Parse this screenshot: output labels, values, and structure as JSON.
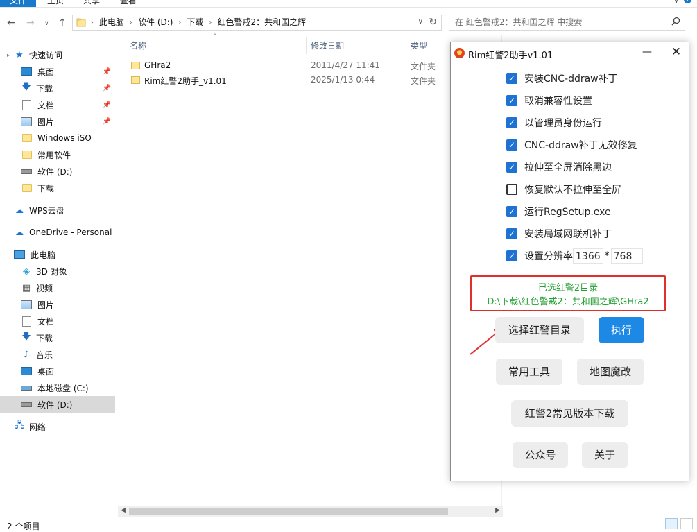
{
  "ribbon": {
    "tabs": [
      "文件",
      "主页",
      "共享",
      "查看"
    ],
    "expand": "∨",
    "help": "?"
  },
  "nav": {
    "back": "←",
    "forward": "→",
    "recent": "∨",
    "up": "↑",
    "breadcrumbs": [
      "此电脑",
      "软件 (D:)",
      "下载",
      "红色警戒2：共和国之辉"
    ],
    "dropdown": "∨",
    "refresh": "↻"
  },
  "search": {
    "placeholder": "在 红色警戒2：共和国之辉 中搜索"
  },
  "sidebar": {
    "quick_access": "快速访问",
    "items": [
      {
        "label": "快速访问",
        "icon": "star-icon"
      },
      {
        "label": "桌面",
        "icon": "desktop-icon",
        "pinned": true
      },
      {
        "label": "下载",
        "icon": "download-icon",
        "pinned": true
      },
      {
        "label": "文档",
        "icon": "document-icon",
        "pinned": true
      },
      {
        "label": "图片",
        "icon": "picture-icon",
        "pinned": true
      },
      {
        "label": "Windows iSO",
        "icon": "folder-icon"
      },
      {
        "label": "常用软件",
        "icon": "folder-icon"
      },
      {
        "label": "软件 (D:)",
        "icon": "drive-icon"
      },
      {
        "label": "下载",
        "icon": "folder-icon"
      },
      {
        "label": "WPS云盘",
        "icon": "cloud-icon"
      },
      {
        "label": "OneDrive - Personal",
        "icon": "onedrive-icon"
      },
      {
        "label": "此电脑",
        "icon": "computer-icon"
      },
      {
        "label": "3D 对象",
        "icon": "3d-objects-icon"
      },
      {
        "label": "视频",
        "icon": "video-icon"
      },
      {
        "label": "图片",
        "icon": "picture-icon"
      },
      {
        "label": "文档",
        "icon": "document-icon"
      },
      {
        "label": "下载",
        "icon": "download-icon"
      },
      {
        "label": "音乐",
        "icon": "music-icon"
      },
      {
        "label": "桌面",
        "icon": "desktop-icon"
      },
      {
        "label": "本地磁盘 (C:)",
        "icon": "local-disk-icon"
      },
      {
        "label": "软件 (D:)",
        "icon": "drive-icon"
      },
      {
        "label": "网络",
        "icon": "network-icon"
      }
    ]
  },
  "columns": {
    "name": "名称",
    "date": "修改日期",
    "type": "类型"
  },
  "files": [
    {
      "name": "GHra2",
      "date": "2011/4/27 11:41",
      "type": "文件夹"
    },
    {
      "name": "Rim红警2助手_v1.01",
      "date": "2025/1/13 0:44",
      "type": "文件夹"
    }
  ],
  "status": {
    "count": "2 个项目"
  },
  "dialog": {
    "title": "Rim红警2助手v1.01",
    "minimize": "—",
    "close": "✕",
    "options": [
      {
        "label": "安装CNC-ddraw补丁",
        "checked": true
      },
      {
        "label": "取消兼容性设置",
        "checked": true
      },
      {
        "label": "以管理员身份运行",
        "checked": true
      },
      {
        "label": "CNC-ddraw补丁无效修复",
        "checked": true
      },
      {
        "label": "拉伸至全屏消除黑边",
        "checked": true
      },
      {
        "label": "恢复默认不拉伸至全屏",
        "checked": false
      },
      {
        "label": "运行RegSetup.exe",
        "checked": true
      },
      {
        "label": "安装局域网联机补丁",
        "checked": true
      },
      {
        "label": "设置分辨率",
        "checked": true
      }
    ],
    "resolution": {
      "width": "1366",
      "sep": "*",
      "height": "768"
    },
    "info_line1": "已选红警2目录",
    "info_line2": "D:\\下载\\红色警戒2：共和国之辉\\GHra2",
    "buttons": {
      "select_dir": "选择红警目录",
      "execute": "执行",
      "tools": "常用工具",
      "map_edit": "地图魔改",
      "download": "红警2常见版本下载",
      "wechat": "公众号",
      "about": "关于"
    },
    "accent_color": "#1e88e5",
    "highlight_color": "#e0302c",
    "info_color": "#22a032"
  }
}
